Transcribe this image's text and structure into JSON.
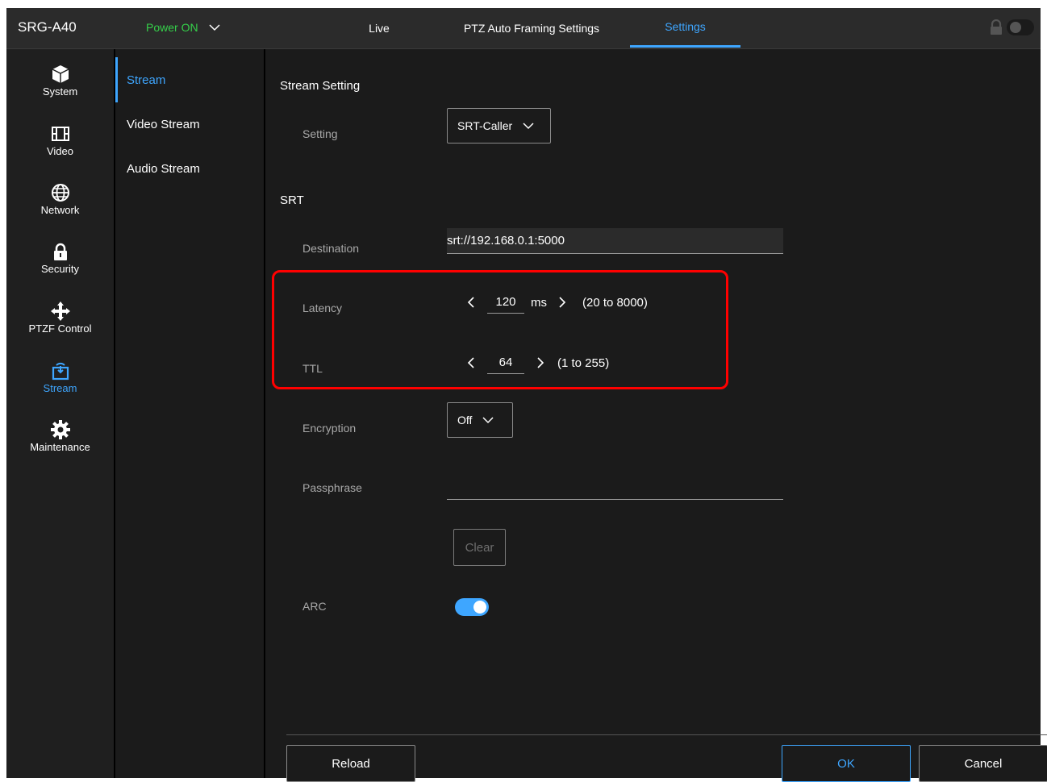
{
  "header": {
    "model": "SRG-A40",
    "power": "Power ON",
    "tabs": [
      {
        "label": "Live"
      },
      {
        "label": "PTZ Auto Framing Settings"
      },
      {
        "label": "Settings"
      }
    ],
    "active_tab": "Settings"
  },
  "icon_nav": {
    "items": [
      {
        "label": "System",
        "icon": "cube-icon"
      },
      {
        "label": "Video",
        "icon": "film-icon"
      },
      {
        "label": "Network",
        "icon": "globe-icon"
      },
      {
        "label": "Security",
        "icon": "lock-icon"
      },
      {
        "label": "PTZF Control",
        "icon": "move-arrows-icon"
      },
      {
        "label": "Stream",
        "icon": "stream-icon"
      },
      {
        "label": "Maintenance",
        "icon": "gear-icon"
      }
    ],
    "active": "Stream"
  },
  "sub_nav": {
    "items": [
      {
        "label": "Stream"
      },
      {
        "label": "Video Stream"
      },
      {
        "label": "Audio Stream"
      }
    ],
    "active": "Stream"
  },
  "main": {
    "stream_setting_title": "Stream Setting",
    "setting_label": "Setting",
    "setting_value": "SRT-Caller",
    "srt_title": "SRT",
    "destination_label": "Destination",
    "destination_value": "srt://192.168.0.1:5000",
    "latency_label": "Latency",
    "latency_value": "120",
    "latency_unit": "ms",
    "latency_range": "(20 to 8000)",
    "ttl_label": "TTL",
    "ttl_value": "64",
    "ttl_range": "(1 to 255)",
    "encryption_label": "Encryption",
    "encryption_value": "Off",
    "passphrase_label": "Passphrase",
    "passphrase_value": "",
    "clear_label": "Clear",
    "arc_label": "ARC",
    "arc_on": true
  },
  "footer": {
    "reload": "Reload",
    "ok": "OK",
    "cancel": "Cancel"
  },
  "colors": {
    "accent": "#3ea6ff",
    "power_green": "#35d04a",
    "highlight_red": "#ff0000"
  }
}
